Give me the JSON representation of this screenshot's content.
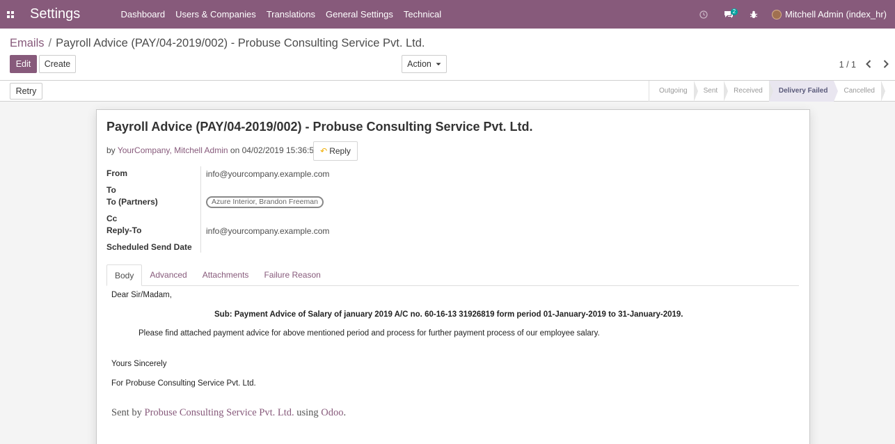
{
  "navbar": {
    "app_title": "Settings",
    "menu": [
      "Dashboard",
      "Users & Companies",
      "Translations",
      "General Settings",
      "Technical"
    ],
    "chat_count": "2",
    "user_name": "Mitchell Admin (index_hr)"
  },
  "breadcrumb": {
    "parent": "Emails",
    "separator": "/",
    "current": "Payroll Advice (PAY/04-2019/002) - Probuse Consulting Service Pvt. Ltd."
  },
  "toolbar": {
    "edit": "Edit",
    "create": "Create",
    "action": "Action",
    "pager": "1 / 1"
  },
  "statusbar": {
    "retry": "Retry",
    "steps": [
      "Outgoing",
      "Sent",
      "Received",
      "Delivery Failed",
      "Cancelled"
    ],
    "active_step": "Delivery Failed"
  },
  "mail": {
    "subject": "Payroll Advice (PAY/04-2019/002) - Probuse Consulting Service Pvt. Ltd.",
    "by_prefix": "by",
    "author": "YourCompany, Mitchell Admin",
    "date_text": "on 04/02/2019 15:36:58",
    "reply": "Reply"
  },
  "fields": {
    "from_label": "From",
    "from_value": "info@yourcompany.example.com",
    "to_label": "To",
    "to_partners_label": "To (Partners)",
    "to_partners_tag": "Azure Interior, Brandon Freeman",
    "cc_label": "Cc",
    "reply_to_label": "Reply-To",
    "reply_to_value": "info@yourcompany.example.com",
    "scheduled_label": "Scheduled Send Date"
  },
  "tabs": [
    "Body",
    "Advanced",
    "Attachments",
    "Failure Reason"
  ],
  "body": {
    "greeting": "Dear Sir/Madam,",
    "sub_line": "Sub: Payment Advice of Salary of january 2019 A/C no. 60-16-13 31926819 form period 01-January-2019 to 31-January-2019.",
    "paragraph": "Please find attached payment advice for above mentioned period and process for further payment process of our employee salary.",
    "closing": "Yours Sincerely",
    "company_line": "For Probuse Consulting Service Pvt. Ltd."
  },
  "footer": {
    "prefix": "Sent by",
    "company": "Probuse Consulting Service Pvt. Ltd.",
    "middle": "using",
    "product": "Odoo",
    "suffix": "."
  },
  "colors": {
    "brand": "#875a7b",
    "navbar": "#875a7b",
    "badge": "#00a09d"
  },
  "icons": [
    "apps-grid-icon",
    "clock-icon",
    "chat-icon",
    "bug-icon",
    "avatar",
    "caret-down-icon",
    "chevron-left-icon",
    "chevron-right-icon",
    "reply-arrow-icon"
  ]
}
